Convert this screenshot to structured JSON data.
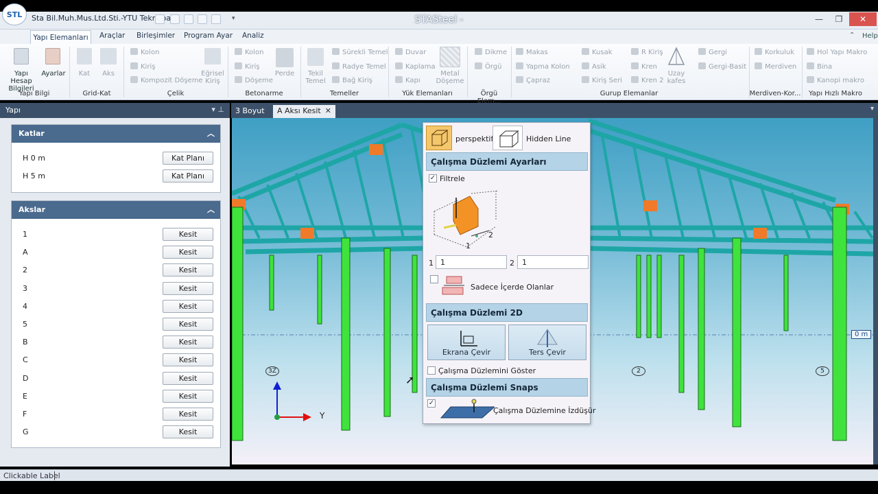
{
  "window": {
    "company": "Sta Bil.Muh.Mus.Ltd.Sti.-YTU Teknopark",
    "title": "STASteel -",
    "logo_text": "STL"
  },
  "ribbon": {
    "tabs": [
      "Yapı Elemanları",
      "Araçlar",
      "Birleşimler",
      "Program Ayar",
      "Analiz"
    ],
    "help": "Help",
    "groups": {
      "yapi_bilgi": {
        "label": "Yapı Bilgi",
        "items": [
          "Yapı Hesap Bilgileri",
          "Ayarlar"
        ]
      },
      "grid_kat": {
        "label": "Grid-Kat",
        "items": [
          "Kat",
          "Aks"
        ]
      },
      "celik": {
        "label": "Çelik",
        "items": [
          "Kolon",
          "Kiriş",
          "Kompozit Döşeme",
          "Eğrisel Kiriş"
        ]
      },
      "betonarme": {
        "label": "Betonarme",
        "items": [
          "Kolon",
          "Kiriş",
          "Döşeme",
          "Perde"
        ]
      },
      "temeller": {
        "label": "Temeller",
        "items": [
          "Tekil Temel",
          "Sürekli Temel",
          "Radye Temel",
          "Bağ Kiriş"
        ]
      },
      "yuk": {
        "label": "Yük Elemanları",
        "items": [
          "Duvar",
          "Kaplama",
          "Kapı",
          "Metal Döşeme"
        ]
      },
      "orgu": {
        "label": "Örgü Elem...",
        "items": [
          "Dikme",
          "Örgü"
        ]
      },
      "gurup": {
        "label": "Gurup Elemanlar",
        "items": [
          "Makas",
          "Yapma Kolon",
          "Çapraz",
          "Kusak",
          "Asik",
          "Kiriş Seri",
          "R Kiriş",
          "Kren",
          "Kren 2",
          "Uzay kafes",
          "Gergi",
          "Gergi-Basit"
        ]
      },
      "merdiven": {
        "label": "Merdiven-Kor...",
        "items": [
          "Korkuluk",
          "Merdiven"
        ]
      },
      "makro": {
        "label": "Yapı Hızlı Makro",
        "items": [
          "Hol Yapı Makro",
          "Bina",
          "Kanopi makro"
        ]
      }
    }
  },
  "left_panel": {
    "title": "Yapı",
    "katlar": {
      "title": "Katlar",
      "rows": [
        {
          "label": "H   0 m",
          "button": "Kat Planı"
        },
        {
          "label": "H   5 m",
          "button": "Kat Planı"
        }
      ]
    },
    "akslar": {
      "title": "Akslar",
      "button": "Kesit",
      "rows": [
        "1",
        "A",
        "2",
        "3",
        "4",
        "5",
        "B",
        "C",
        "D",
        "E",
        "F",
        "G"
      ]
    }
  },
  "doc_tabs": [
    "3 Boyut",
    "A Aksı Kesit"
  ],
  "viewport": {
    "axis_bubbles": [
      "3Z",
      "2",
      "5"
    ],
    "axis_y_label": "Y",
    "level_label": "0 m"
  },
  "popup": {
    "view_mode": "perspektif",
    "render_mode": "Hidden Line",
    "settings_title": "Çalışma Düzlemi Ayarları",
    "filter_label": "Filtrele",
    "filter_checked": true,
    "field1_label": "1",
    "field1_value": "1",
    "field2_label": "2",
    "field2_value": "1",
    "inside_only_label": "Sadece İçerde Olanlar",
    "inside_only_checked": false,
    "diagram_labels": [
      "1",
      "2"
    ],
    "plane2d_title": "Çalışma Düzlemi 2D",
    "btn_rotate": "Ekrana Çevir",
    "btn_reverse": "Ters Çevir",
    "show_plane_label": "Çalışma Düzlemini Göster",
    "show_plane_checked": false,
    "snaps_title": "Çalışma Düzlemi Snaps",
    "project_label": "Çalışma Düzlemine İzdüşür",
    "project_checked": true
  },
  "status": {
    "text": "Clickable Label"
  },
  "colors": {
    "column_green": "#3fe33c",
    "truss_teal": "#1ea6a6",
    "gusset_orange": "#f07a2a",
    "panel_header": "#3c5169",
    "section_header": "#4a6a8e"
  }
}
